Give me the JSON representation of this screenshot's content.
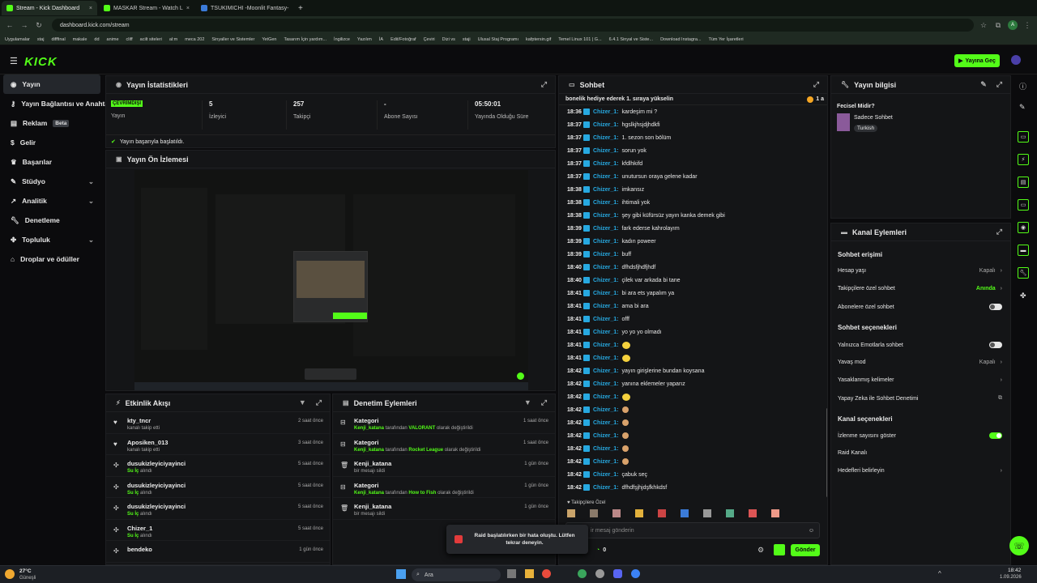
{
  "browser": {
    "tabs": [
      {
        "label": "Stream - Kick Dashboard",
        "close": "×"
      },
      {
        "label": "MASKAR Stream - Watch L",
        "close": "×"
      },
      {
        "label": "TSUKIMICHI -Moonlit Fantasy-",
        "close": "×"
      }
    ],
    "new_tab": "+",
    "url": "dashboard.kick.com/stream",
    "bookmarks": [
      "Uygulamalar",
      "staj",
      "difffinal",
      "makale",
      "dd",
      "anime",
      "cliff",
      "acilt siteleri",
      "al:m",
      "meca 202",
      "Sinyaller ve Sistemler",
      "YetGen",
      "Tasarım İçin yardım...",
      "İngilizce",
      "Yazılım",
      "İA",
      "Edit/Fotoğraf",
      "Çeviri",
      "Dizi vs",
      "staji",
      "Ulusal Staj Programı",
      "kafptersin.gif",
      "Temel Linux 101 | G...",
      "6.4.1 Sinyal ve Siste...",
      "Download Instagra...",
      "Tüm Yer İşaretleri"
    ]
  },
  "header": {
    "logo": "KICK",
    "go_live": "Yayına Geç"
  },
  "sidebar": {
    "items": [
      {
        "label": "Yayın"
      },
      {
        "label": "Yayın Bağlantısı ve Anahtarı"
      },
      {
        "label": "Reklam",
        "badge": "Beta"
      },
      {
        "label": "Gelir"
      },
      {
        "label": "Başarılar"
      },
      {
        "label": "Stüdyo"
      },
      {
        "label": "Analitik"
      },
      {
        "label": "Denetleme"
      },
      {
        "label": "Topluluk"
      },
      {
        "label": "Droplar ve ödüller"
      }
    ]
  },
  "stats": {
    "title": "Yayın İstatistikleri",
    "status_badge": "ÇEVRİMDIŞI",
    "cells": [
      {
        "value": "",
        "label": "Yayın"
      },
      {
        "value": "5",
        "label": "İzleyici"
      },
      {
        "value": "257",
        "label": "Takipçi"
      },
      {
        "value": "-",
        "label": "Abone Sayısı"
      },
      {
        "value": "05:50:01",
        "label": "Yayında Olduğu Süre"
      }
    ],
    "success": "Yayın başarıyla başlatıldı."
  },
  "preview": {
    "title": "Yayın Ön İzlemesi"
  },
  "activity": {
    "title": "Etkinlik Akışı",
    "items": [
      {
        "name": "kty_tncr",
        "sub": "kanalı takip etti",
        "time": "2 saat önce",
        "icon": "heart"
      },
      {
        "name": "Aposiken_013",
        "sub": "kanalı takip etti",
        "time": "3 saat önce",
        "icon": "heart"
      },
      {
        "name": "dusukizleyiciyayinci",
        "hl": "Su İç",
        "sub": "alındı",
        "time": "5 saat önce",
        "icon": "reward"
      },
      {
        "name": "dusukizleyiciyayinci",
        "hl": "Su İç",
        "sub": "alındı",
        "time": "5 saat önce",
        "icon": "reward"
      },
      {
        "name": "dusukizleyiciyayinci",
        "hl": "Su İç",
        "sub": "alındı",
        "time": "5 saat önce",
        "icon": "reward"
      },
      {
        "name": "Chizer_1",
        "hl": "Su İç",
        "sub": "alındı",
        "time": "5 saat önce",
        "icon": "reward"
      },
      {
        "name": "bendeko",
        "sub": "",
        "time": "1 gün önce",
        "icon": "reward"
      }
    ]
  },
  "moderation": {
    "title": "Denetim Eylemleri",
    "items": [
      {
        "name": "Kategori",
        "actor": "Kenji_katana",
        "mid": "tarafından",
        "hl": "VALORANT",
        "tail": "olarak değiştirildi",
        "time": "1 saat önce"
      },
      {
        "name": "Kategori",
        "actor": "Kenji_katana",
        "mid": "tarafından",
        "hl": "Rocket League",
        "tail": "olarak değiştirildi",
        "time": "1 saat önce"
      },
      {
        "name": "Kenji_katana",
        "actor": "",
        "mid": "",
        "hl": "",
        "tail": "bir mesajı sildi",
        "time": "1 gün önce"
      },
      {
        "name": "Kategori",
        "actor": "Kenji_katana",
        "mid": "tarafından",
        "hl": "How to Fish",
        "tail": "olarak değiştirildi",
        "time": "1 gün önce"
      },
      {
        "name": "Kenji_katana",
        "actor": "",
        "mid": "",
        "hl": "",
        "tail": "bir mesajı sildi",
        "time": "1 gün önce"
      }
    ]
  },
  "chat": {
    "title": "Sohbet",
    "pinned": "bonelik hediye ederek 1. sıraya yükselin",
    "pinned_count": "1 a",
    "messages": [
      {
        "t": "18:36",
        "u": "Chizer_1:",
        "m": "kardeşim mi ?"
      },
      {
        "t": "18:37",
        "u": "Chizer_1:",
        "m": "hgslkjhsjdjhdkfi"
      },
      {
        "t": "18:37",
        "u": "Chizer_1:",
        "m": "1. sezon son bölüm"
      },
      {
        "t": "18:37",
        "u": "Chizer_1:",
        "m": "sorun yok"
      },
      {
        "t": "18:37",
        "u": "Chizer_1:",
        "m": "kfdlhkifd"
      },
      {
        "t": "18:37",
        "u": "Chizer_1:",
        "m": "unutursun oraya gelene kadar"
      },
      {
        "t": "18:38",
        "u": "Chizer_1:",
        "m": "imkansız"
      },
      {
        "t": "18:38",
        "u": "Chizer_1:",
        "m": "ihtimali yok"
      },
      {
        "t": "18:38",
        "u": "Chizer_1:",
        "m": "şey gibi küfürsüz yayın kanka demek gibi"
      },
      {
        "t": "18:39",
        "u": "Chizer_1:",
        "m": "fark ederse kahrolayım"
      },
      {
        "t": "18:39",
        "u": "Chizer_1:",
        "m": "kadın poweer"
      },
      {
        "t": "18:39",
        "u": "Chizer_1:",
        "m": "buff"
      },
      {
        "t": "18:40",
        "u": "Chizer_1:",
        "m": "dfhdsfjhdfjhdf"
      },
      {
        "t": "18:40",
        "u": "Chizer_1:",
        "m": "çilek var arkada bi tane"
      },
      {
        "t": "18:41",
        "u": "Chizer_1:",
        "m": "bi ara ets yapalım ya"
      },
      {
        "t": "18:41",
        "u": "Chizer_1:",
        "m": "ama bi ara"
      },
      {
        "t": "18:41",
        "u": "Chizer_1:",
        "m": "offf"
      },
      {
        "t": "18:41",
        "u": "Chizer_1:",
        "m": "yo yo yo olmadı"
      },
      {
        "t": "18:41",
        "u": "Chizer_1:",
        "m": "",
        "emote": "y"
      },
      {
        "t": "18:41",
        "u": "Chizer_1:",
        "m": "",
        "emote": "y"
      },
      {
        "t": "18:42",
        "u": "Chizer_1:",
        "m": "yayın girişlerine bundan koysana"
      },
      {
        "t": "18:42",
        "u": "Chizer_1:",
        "m": "yanına eklemeler yaparız"
      },
      {
        "t": "18:42",
        "u": "Chizer_1:",
        "m": "",
        "emote": "y"
      },
      {
        "t": "18:42",
        "u": "Chizer_1:",
        "m": "",
        "emote": "s"
      },
      {
        "t": "18:42",
        "u": "Chizer_1:",
        "m": "",
        "emote": "s"
      },
      {
        "t": "18:42",
        "u": "Chizer_1:",
        "m": "",
        "emote": "s"
      },
      {
        "t": "18:42",
        "u": "Chizer_1:",
        "m": "",
        "emote": "s"
      },
      {
        "t": "18:42",
        "u": "Chizer_1:",
        "m": "",
        "emote": "s"
      },
      {
        "t": "18:42",
        "u": "Chizer_1:",
        "m": "çabuk seç"
      },
      {
        "t": "18:42",
        "u": "Chizer_1:",
        "m": "dfhdfşjhjdşfkhkdsf"
      }
    ],
    "followers_label": "Takipçilere Özel",
    "input_placeholder": "ir mesaj gönderin",
    "points": "0",
    "send": "Gönder"
  },
  "toast": {
    "text": "Raid başlatılırken bir hata oluştu. Lütfen tekrar deneyin."
  },
  "stream_info": {
    "title": "Yayın bilgisi",
    "question": "Fecisel Midir?",
    "name": "Sadece Sohbet",
    "tag": "Turkish"
  },
  "channel_actions": {
    "title": "Kanal Eylemleri",
    "chat_access": "Sohbet erişimi",
    "slow_mode_label": "Hesap yaşı",
    "slow_mode_value": "Kapalı",
    "followers_only": "Takipçilere özel sohbet",
    "followers_value": "Anında",
    "subs_only": "Abonelere özel sohbet",
    "chat_options": "Sohbet seçenekleri",
    "emote_only": "Yalnızca Emotlarla sohbet",
    "slow": "Yavaş mod",
    "slow_value": "Kapalı",
    "banned_words": "Yasaklanmış kelimeler",
    "ai_mod": "Yapay Zeka ile Sohbet Denetimi",
    "channel_options": "Kanal seçenekleri",
    "show_viewers": "İzlenme sayısını göster",
    "raid": "Raid Kanalı",
    "goals": "Hedefleri belirleyin"
  },
  "taskbar": {
    "weather_temp": "27°C",
    "weather_desc": "Güneşli",
    "search": "Ara",
    "time": "18:42",
    "date": "1.09.2026"
  },
  "colors": {
    "accent": "#53fc18",
    "username": "#27a9e1",
    "panel": "#141517"
  }
}
